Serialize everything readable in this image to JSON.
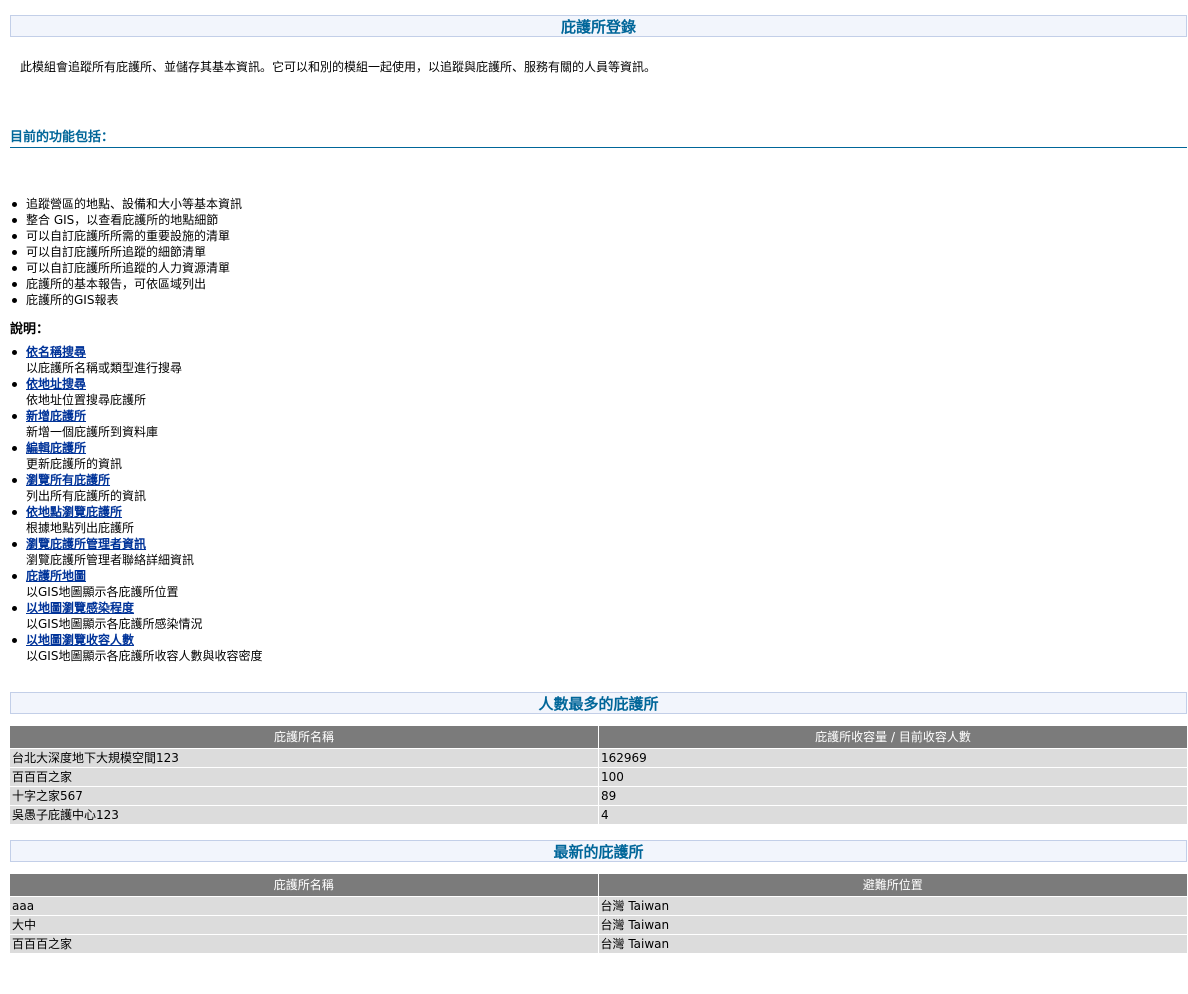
{
  "registry": {
    "title": "庇護所登錄",
    "intro": "此模組會追蹤所有庇護所、並儲存其基本資訊。它可以和別的模組一起使用，以追蹤與庇護所、服務有關的人員等資訊。"
  },
  "features": {
    "heading": "目前的功能包括：",
    "items": [
      "追蹤營區的地點、設備和大小等基本資訊",
      "整合 GIS，以查看庇護所的地點細節",
      "可以自訂庇護所所需的重要設施的清單",
      "可以自訂庇護所所追蹤的細節清單",
      "可以自訂庇護所所追蹤的人力資源清單",
      "庇護所的基本報告，可依區域列出",
      "庇護所的GIS報表"
    ]
  },
  "help": {
    "heading": "說明：",
    "items": [
      {
        "label": "依名稱搜尋 ",
        "desc": "以庇護所名稱或類型進行搜尋"
      },
      {
        "label": "依地址搜尋 ",
        "desc": "依地址位置搜尋庇護所"
      },
      {
        "label": "新增庇護所",
        "desc": "新增一個庇護所到資料庫"
      },
      {
        "label": "編輯庇護所",
        "desc": "更新庇護所的資訊"
      },
      {
        "label": "瀏覽所有庇護所",
        "desc": "列出所有庇護所的資訊"
      },
      {
        "label": "依地點瀏覽庇護所",
        "desc": "根據地點列出庇護所"
      },
      {
        "label": "瀏覽庇護所管理者資訊",
        "desc": "瀏覽庇護所管理者聯絡詳細資訊"
      },
      {
        "label": "庇護所地圖",
        "desc": "以GIS地圖顯示各庇護所位置"
      },
      {
        "label": "以地圖瀏覽感染程度",
        "desc": "以GIS地圖顯示各庇護所感染情況"
      },
      {
        "label": "以地圖瀏覽收容人數",
        "desc": "以GIS地圖顯示各庇護所收容人數與收容密度"
      }
    ]
  },
  "most_populous": {
    "title": "人數最多的庇護所",
    "columns": [
      "庇護所名稱",
      "庇護所收容量 / 目前收容人數"
    ],
    "rows": [
      [
        "台北大深度地下大規模空間123",
        "162969"
      ],
      [
        "百百百之家",
        "100"
      ],
      [
        "十字之家567",
        "89"
      ],
      [
        "吳愚子庇護中心123",
        "4"
      ]
    ]
  },
  "newest": {
    "title": "最新的庇護所",
    "columns": [
      "庇護所名稱",
      "避難所位置"
    ],
    "rows": [
      [
        "aaa",
        "台灣 Taiwan"
      ],
      [
        "大中",
        "台灣 Taiwan"
      ],
      [
        "百百百之家",
        "台灣 Taiwan"
      ]
    ]
  }
}
